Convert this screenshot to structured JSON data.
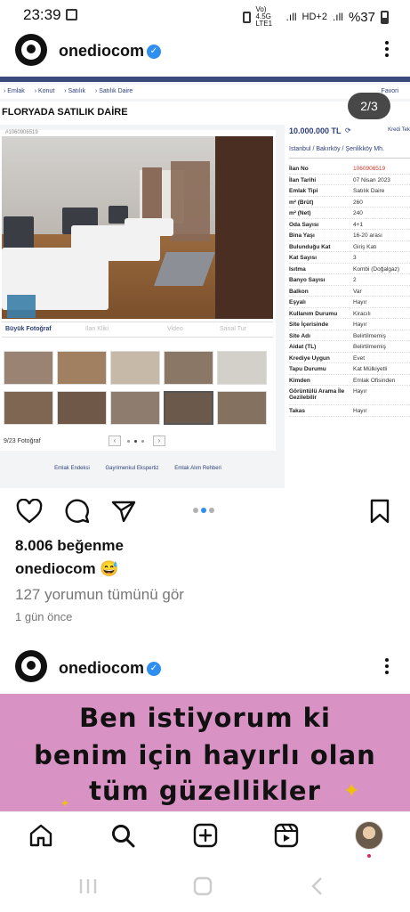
{
  "status_bar": {
    "time": "23:39",
    "network": "Vo) 4.5G LTE1",
    "signal": "HD+2",
    "battery": "%37"
  },
  "post1": {
    "username": "onediocom",
    "image": {
      "breadcrumbs": [
        "Emlak",
        "Konut",
        "Satılık",
        "Satılık Daire"
      ],
      "favorites": "Favori",
      "title": "FLORYADA SATILIK DAİRE",
      "pager": "2/3",
      "listing_no_small": "#1060906519",
      "photo_tabs": [
        "Büyük Fotoğraf",
        "İlan Kliki",
        "Video",
        "Sanal Tur"
      ],
      "photo_count": "9/23 Fotoğraf",
      "footer_links": [
        "Emlak Endeksi",
        "Gayrimenkul Ekspertiz",
        "Emlak Alım Rehberi"
      ],
      "price": "10.000.000 TL",
      "kredi": "Kredi Tek",
      "location": "İstanbul / Bakırköy / Şenlikköy Mh.",
      "details": [
        {
          "k": "İlan No",
          "v": "1060906519",
          "red": true
        },
        {
          "k": "İlan Tarihi",
          "v": "07 Nisan 2023"
        },
        {
          "k": "Emlak Tipi",
          "v": "Satılık Daire"
        },
        {
          "k": "m² (Brüt)",
          "v": "260"
        },
        {
          "k": "m² (Net)",
          "v": "240"
        },
        {
          "k": "Oda Sayısı",
          "v": "4+1"
        },
        {
          "k": "Bina Yaşı",
          "v": "16-20 arası"
        },
        {
          "k": "Bulunduğu Kat",
          "v": "Giriş Katı"
        },
        {
          "k": "Kat Sayısı",
          "v": "3"
        },
        {
          "k": "Isıtma",
          "v": "Kombi (Doğalgaz)"
        },
        {
          "k": "Banyo Sayısı",
          "v": "2"
        },
        {
          "k": "Balkon",
          "v": "Var"
        },
        {
          "k": "Eşyalı",
          "v": "Hayır"
        },
        {
          "k": "Kullanım Durumu",
          "v": "Kiracılı"
        },
        {
          "k": "Site İçerisinde",
          "v": "Hayır"
        },
        {
          "k": "Site Adı",
          "v": "Belirtilmemiş"
        },
        {
          "k": "Aidat (TL)",
          "v": "Belirtilmemiş"
        },
        {
          "k": "Krediye Uygun",
          "v": "Evet"
        },
        {
          "k": "Tapu Durumu",
          "v": "Kat Mülkiyetli"
        },
        {
          "k": "Kimden",
          "v": "Emlak Ofisinden"
        },
        {
          "k": "Görüntülü Arama İle Gezilebilir",
          "v": "Hayır"
        },
        {
          "k": "Takas",
          "v": "Hayır"
        }
      ]
    },
    "likes": "8.006 beğenme",
    "caption_user": "onediocom",
    "caption_emoji": "😅",
    "comments_link": "127 yorumun tümünü gör",
    "time_ago": "1 gün önce"
  },
  "post2": {
    "username": "onediocom",
    "banner_lines": [
      "Ben istiyorum ki",
      "benim için hayırlı olan",
      "tüm güzellikler"
    ],
    "banner_color": "#d893c4"
  },
  "icons": [
    "heart-icon",
    "comment-icon",
    "share-icon",
    "bookmark-icon",
    "home-icon",
    "search-icon",
    "create-icon",
    "reels-icon"
  ]
}
